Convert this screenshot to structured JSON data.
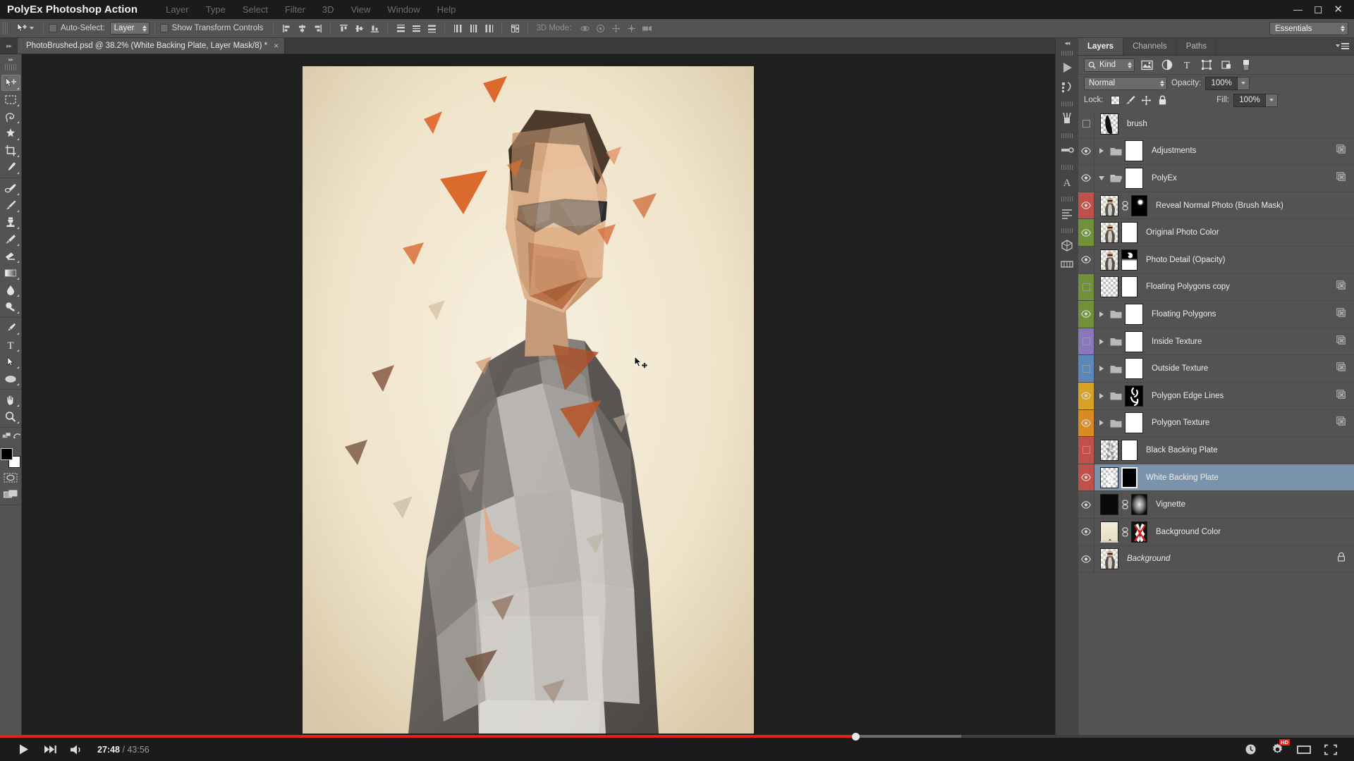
{
  "app": {
    "title": "PolyEx Photoshop Action",
    "menus": [
      "Layer",
      "Type",
      "Select",
      "Filter",
      "3D",
      "View",
      "Window",
      "Help"
    ],
    "window_buttons": [
      "minimize-icon",
      "maximize-icon",
      "close-icon"
    ]
  },
  "options_bar": {
    "tool_icon": "move-tool-icon",
    "auto_select_label": "Auto-Select:",
    "auto_select_checked": false,
    "auto_select_target": "Layer",
    "show_transform_label": "Show Transform Controls",
    "show_transform_checked": false,
    "mode_3d_label": "3D Mode:",
    "align_icons": [
      "align-left-edges-icon",
      "align-horizontal-centers-icon",
      "align-right-edges-icon",
      "align-top-edges-icon",
      "align-vertical-centers-icon",
      "align-bottom-edges-icon"
    ],
    "distribute_icons": [
      "distribute-top-edges-icon",
      "distribute-vertical-centers-icon",
      "distribute-bottom-edges-icon",
      "distribute-left-edges-icon",
      "distribute-horizontal-centers-icon",
      "distribute-right-edges-icon",
      "auto-align-layers-icon"
    ],
    "mode_3d_icons": [
      "orbit-3d-icon",
      "roll-3d-icon",
      "pan-3d-icon",
      "slide-3d-icon",
      "scale-3d-icon"
    ],
    "workspace": "Essentials"
  },
  "document": {
    "tab_title": "PhotoBrushed.psd @ 38.2% (White Backing Plate, Layer Mask/8) *",
    "close_label": "×",
    "zoom_level": "38.2%",
    "active_layer": "White Backing Plate",
    "channel": "Layer Mask/8",
    "modified": true
  },
  "toolbar": {
    "tools": [
      {
        "name": "move-tool",
        "active": true
      },
      {
        "name": "rectangular-marquee-tool",
        "active": false
      },
      {
        "name": "lasso-tool",
        "active": false
      },
      {
        "name": "quick-selection-tool",
        "active": false
      },
      {
        "name": "crop-tool",
        "active": false
      },
      {
        "name": "eyedropper-tool",
        "active": false
      },
      {
        "name": "spot-healing-brush-tool",
        "active": false
      },
      {
        "name": "brush-tool",
        "active": false
      },
      {
        "name": "clone-stamp-tool",
        "active": false
      },
      {
        "name": "history-brush-tool",
        "active": false
      },
      {
        "name": "eraser-tool",
        "active": false
      },
      {
        "name": "gradient-tool",
        "active": false
      },
      {
        "name": "blur-tool",
        "active": false
      },
      {
        "name": "dodge-tool",
        "active": false
      },
      {
        "name": "pen-tool",
        "active": false
      },
      {
        "name": "horizontal-type-tool",
        "active": false
      },
      {
        "name": "path-selection-tool",
        "active": false
      },
      {
        "name": "ellipse-tool",
        "active": false
      },
      {
        "name": "hand-tool",
        "active": false
      },
      {
        "name": "zoom-tool",
        "active": false
      }
    ],
    "foreground_color": "#000000",
    "background_color": "#ffffff",
    "quick_mask_label": "edit-in-quick-mask-mode",
    "screen_mode_label": "change-screen-mode"
  },
  "icon_dock": {
    "groups": [
      [
        "history-panel-icon",
        "actions-panel-icon"
      ],
      [
        "brush-panel-icon"
      ],
      [
        "clone-source-panel-icon"
      ],
      [
        "character-panel-icon"
      ],
      [
        "paragraph-panel-icon"
      ],
      [
        "3d-panel-icon",
        "timeline-panel-icon"
      ]
    ]
  },
  "layers_panel": {
    "tabs": [
      {
        "label": "Layers",
        "active": true
      },
      {
        "label": "Channels",
        "active": false
      },
      {
        "label": "Paths",
        "active": false
      }
    ],
    "filter": {
      "kind_label": "Kind",
      "icons": [
        "filter-pixel-icon",
        "filter-adjustment-icon",
        "filter-type-icon",
        "filter-shape-icon",
        "filter-smartobject-icon"
      ],
      "toggle": "filter-enable-toggle"
    },
    "blend_mode": "Normal",
    "opacity_label": "Opacity:",
    "opacity_value": "100%",
    "lock_label": "Lock:",
    "lock_icons": [
      "lock-transparent-pixels-icon",
      "lock-image-pixels-icon",
      "lock-position-icon",
      "lock-all-icon"
    ],
    "fill_label": "Fill:",
    "fill_value": "100%",
    "layers": [
      {
        "name": "brush",
        "visible": false,
        "type": "layer",
        "color_tag": "none",
        "thumb": "brush-shape-thumb",
        "has_mask": false,
        "selected": false,
        "expanded": null,
        "locked": false,
        "italic": false,
        "has_fx_badge": false
      },
      {
        "name": "Adjustments",
        "visible": true,
        "type": "group",
        "color_tag": "none",
        "thumb": "white-thumb",
        "has_mask": false,
        "selected": false,
        "expanded": false,
        "locked": false,
        "italic": false,
        "has_fx_badge": true
      },
      {
        "name": "PolyEx",
        "visible": true,
        "type": "group",
        "color_tag": "none",
        "thumb": "white-thumb",
        "has_mask": false,
        "selected": false,
        "expanded": true,
        "locked": false,
        "italic": false,
        "has_fx_badge": true
      },
      {
        "name": "Reveal Normal Photo (Brush Mask)",
        "visible": true,
        "type": "layer",
        "color_tag": "#c0504a",
        "thumb": "photo-thumb",
        "has_mask": true,
        "mask": "black-dot-mask",
        "linked": true,
        "selected": false,
        "expanded": null,
        "locked": false,
        "italic": false,
        "has_fx_badge": false
      },
      {
        "name": "Original Photo Color",
        "visible": true,
        "type": "layer",
        "color_tag": "#70903a",
        "thumb": "photo-thumb",
        "has_mask": true,
        "mask": "white-mask",
        "linked": false,
        "selected": false,
        "expanded": null,
        "locked": false,
        "italic": false,
        "has_fx_badge": false
      },
      {
        "name": "Photo Detail (Opacity)",
        "visible": true,
        "type": "layer",
        "color_tag": "none",
        "thumb": "photo-thumb",
        "has_mask": true,
        "mask": "gradient-mask",
        "linked": false,
        "selected": false,
        "expanded": null,
        "locked": false,
        "italic": false,
        "has_fx_badge": false
      },
      {
        "name": "Floating Polygons copy",
        "visible": false,
        "type": "layer",
        "color_tag": "#70903a",
        "thumb": "checker-thumb",
        "has_mask": true,
        "mask": "white-mask",
        "linked": false,
        "selected": false,
        "expanded": null,
        "locked": false,
        "italic": false,
        "has_fx_badge": true
      },
      {
        "name": "Floating Polygons",
        "visible": true,
        "type": "group",
        "color_tag": "#70903a",
        "thumb": "white-thumb",
        "has_mask": false,
        "selected": false,
        "expanded": false,
        "locked": false,
        "italic": false,
        "has_fx_badge": true
      },
      {
        "name": "Inside Texture",
        "visible": false,
        "type": "group",
        "color_tag": "#8878b8",
        "thumb": "white-thumb",
        "has_mask": false,
        "selected": false,
        "expanded": false,
        "locked": false,
        "italic": false,
        "has_fx_badge": true
      },
      {
        "name": "Outside Texture",
        "visible": false,
        "type": "group",
        "color_tag": "#5c87b8",
        "thumb": "white-thumb",
        "has_mask": false,
        "selected": false,
        "expanded": false,
        "locked": false,
        "italic": false,
        "has_fx_badge": true
      },
      {
        "name": "Polygon Edge Lines",
        "visible": true,
        "type": "group",
        "color_tag": "#d8a227",
        "thumb": "edge-lines-thumb",
        "has_mask": false,
        "selected": false,
        "expanded": false,
        "locked": false,
        "italic": false,
        "has_fx_badge": true
      },
      {
        "name": "Polygon Texture",
        "visible": true,
        "type": "group",
        "color_tag": "#d98b23",
        "thumb": "white-thumb",
        "has_mask": false,
        "selected": false,
        "expanded": false,
        "locked": false,
        "italic": false,
        "has_fx_badge": true
      },
      {
        "name": "Black Backing Plate",
        "visible": false,
        "type": "layer",
        "color_tag": "#c0504a",
        "thumb": "grey-speckle-thumb",
        "has_mask": true,
        "mask": "white-mask",
        "linked": false,
        "selected": false,
        "expanded": null,
        "locked": false,
        "italic": false,
        "has_fx_badge": false
      },
      {
        "name": "White Backing Plate",
        "visible": true,
        "type": "layer",
        "color_tag": "#c0504a",
        "thumb": "white-speckle-thumb",
        "has_mask": true,
        "mask": "black-mask",
        "linked": false,
        "selected": true,
        "expanded": null,
        "locked": false,
        "italic": false,
        "has_fx_badge": false
      },
      {
        "name": "Vignette",
        "visible": true,
        "type": "layer",
        "color_tag": "none",
        "thumb": "black-thumb",
        "has_mask": true,
        "mask": "vignette-mask",
        "linked": true,
        "selected": false,
        "expanded": null,
        "locked": false,
        "italic": false,
        "has_fx_badge": false
      },
      {
        "name": "Background Color",
        "visible": true,
        "type": "layer",
        "color_tag": "none",
        "thumb": "gradient-fill-thumb",
        "has_mask": true,
        "mask": "red-x-mask",
        "linked": true,
        "selected": false,
        "expanded": null,
        "locked": false,
        "italic": false,
        "has_fx_badge": false
      },
      {
        "name": "Background",
        "visible": true,
        "type": "layer",
        "color_tag": "none",
        "thumb": "photo-thumb",
        "has_mask": false,
        "selected": false,
        "expanded": null,
        "locked": true,
        "italic": true,
        "has_fx_badge": false
      }
    ]
  },
  "player": {
    "play_icon": "play-icon",
    "next_icon": "next-video-icon",
    "volume_icon": "volume-on-icon",
    "current_time": "27:48",
    "separator": "/",
    "total_time": "43:56",
    "progress_percent": 63.2,
    "buffer_percent": 71,
    "right_icons": [
      "watch-later-icon",
      "settings-gear-icon",
      "theater-mode-icon",
      "fullscreen-icon"
    ],
    "quality_badge": "HD",
    "progress_color": "#e62117"
  },
  "artwork": {
    "description": "low-poly portrait of bearded man with sunglasses",
    "background_color": "#f3ead6",
    "accent_color": "#d95b28"
  }
}
